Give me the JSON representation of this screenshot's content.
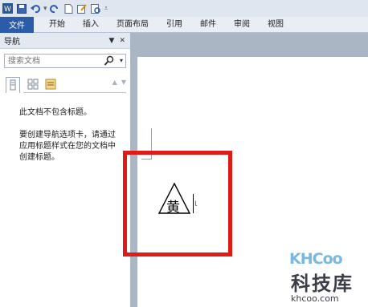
{
  "ribbon": {
    "file_tab": "文件",
    "tabs": [
      "开始",
      "插入",
      "页面布局",
      "引用",
      "邮件",
      "审阅",
      "视图"
    ]
  },
  "nav_pane": {
    "title": "导航",
    "search_placeholder": "搜索文档",
    "message_line1": "此文档不包含标题。",
    "message_line2": "要创建导航选项卡，请通过应用标题样式在您的文档中创建标题。"
  },
  "document": {
    "symbol_char": "黄"
  },
  "watermark": {
    "logo": "KHCoo",
    "cn_text": "科技库",
    "url": "khcoo.com"
  },
  "colors": {
    "file_tab": "#2a5caa",
    "highlight_box": "#e01b16",
    "doc_background": "#abb6c5"
  }
}
